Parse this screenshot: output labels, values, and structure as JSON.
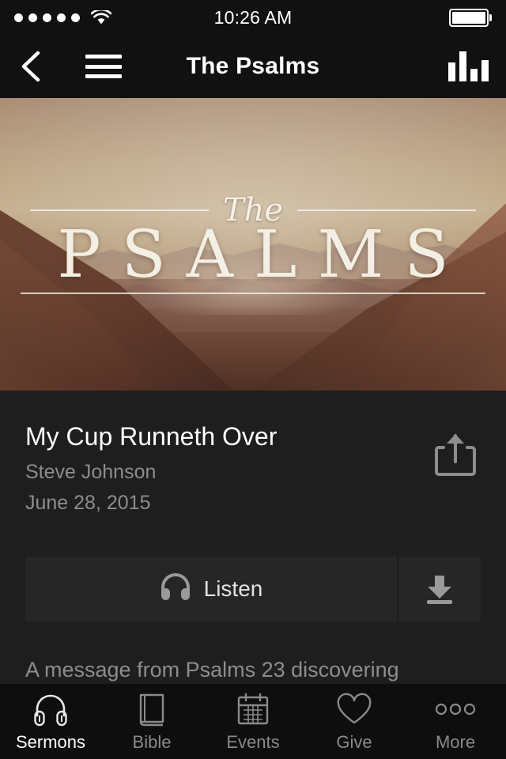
{
  "status_bar": {
    "signal_dots": 5,
    "signal_icon": "signal-dots-icon",
    "wifi_icon": "wifi-icon",
    "time": "10:26 AM",
    "battery_icon": "battery-full-icon",
    "battery_level": 100
  },
  "nav_bar": {
    "back_icon": "chevron-left-icon",
    "menu_icon": "hamburger-menu-icon",
    "title": "The Psalms",
    "chart_icon": "bar-chart-icon"
  },
  "hero": {
    "series_script": "The",
    "series_name": "PSALMS",
    "image_description": "sepia mountain valley landscape",
    "colors": {
      "sky": "#c6b49c",
      "slope": "#6d4535",
      "type": "#f4efe4"
    }
  },
  "sermon": {
    "title": "My Cup Runneth Over",
    "speaker": "Steve Johnson",
    "date": "June 28, 2015",
    "share_icon": "share-icon",
    "listen_label": "Listen",
    "listen_icon": "headphones-icon",
    "download_icon": "download-icon",
    "description": "A message from Psalms 23 discovering"
  },
  "tab_bar": {
    "items": [
      {
        "label": "Sermons",
        "icon": "headphones-icon",
        "active": true
      },
      {
        "label": "Bible",
        "icon": "book-icon",
        "active": false
      },
      {
        "label": "Events",
        "icon": "calendar-icon",
        "active": false
      },
      {
        "label": "Give",
        "icon": "heart-icon",
        "active": false
      },
      {
        "label": "More",
        "icon": "ellipsis-icon",
        "active": false
      }
    ]
  }
}
